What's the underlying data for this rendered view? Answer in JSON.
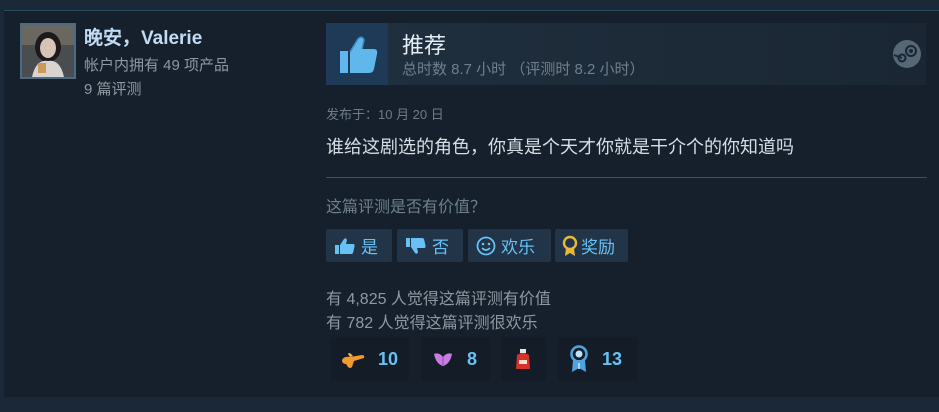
{
  "author": {
    "name": "晚安，Valerie",
    "owned": "帐户内拥有 49 项产品",
    "reviews": "9 篇评测"
  },
  "recommendation": {
    "title": "推荐",
    "hours": "总时数 8.7 小时 （评测时 8.2 小时）"
  },
  "review": {
    "posted": "发布于：10 月 20 日",
    "text": "谁给这剧选的角色，你真是个天才你就是干介个的你知道吗"
  },
  "helpful": {
    "question": "这篇评测是否有价值？",
    "yes": "是",
    "no": "否",
    "funny": "欢乐",
    "award": "奖励"
  },
  "stats": {
    "helpful": "有 4,825 人觉得这篇评测有价值",
    "funny": "有 782 人觉得这篇评测很欢乐"
  },
  "awards": [
    {
      "icon": "hand-gun-icon",
      "count": "10"
    },
    {
      "icon": "lips-icon",
      "count": "8"
    },
    {
      "icon": "ketchup-icon",
      "count": ""
    },
    {
      "icon": "medal-icon",
      "count": "13"
    }
  ],
  "colors": {
    "accent": "#67c1f5",
    "background": "#1b2838",
    "card": "#16202d"
  }
}
